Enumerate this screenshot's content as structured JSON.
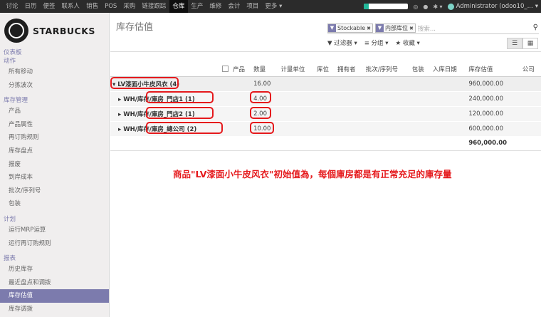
{
  "topbar": {
    "menu": [
      "讨论",
      "日历",
      "便签",
      "联系人",
      "销售",
      "POS",
      "采购",
      "链接跟踪",
      "仓库",
      "生产",
      "维修",
      "会计",
      "项目",
      "更多 ▾"
    ],
    "active_index": 8,
    "progress_fraction": 0.1,
    "user_label": "Administrator (odoo10_...",
    "icons": [
      "camera-icon",
      "chat-icon",
      "gear-icon"
    ]
  },
  "sidebar": {
    "brand": "STARBUCKS",
    "sections": [
      {
        "title": "仪表板",
        "items": []
      },
      {
        "title": "动作",
        "items": [
          "所有移动",
          "分拣波次"
        ]
      },
      {
        "title": "库存管理",
        "items": [
          "产品",
          "产品属性",
          "再订购规则",
          "库存盘点",
          "报废",
          "到岸成本",
          "批次/序列号",
          "包装"
        ]
      },
      {
        "title": "计划",
        "items": [
          "运行MRP运算",
          "运行再订购规则"
        ]
      },
      {
        "title": "报表",
        "items": [
          "历史库存",
          "最近盘点和调拨",
          "库存估值",
          "库存调拨"
        ]
      }
    ],
    "active_item": "库存估值"
  },
  "page": {
    "title": "库存估值",
    "facets": [
      {
        "label": "Stockable",
        "icon": "filter-icon"
      },
      {
        "label": "内部库位",
        "icon": "filter-icon"
      }
    ],
    "search_placeholder": "搜索...",
    "filter_label": "▼ 过滤器 ▾",
    "group_label": "≡ 分组 ▾",
    "favorites_label": "★ 收藏 ▾"
  },
  "table": {
    "columns": [
      "产品",
      "数量",
      "计量单位",
      "库位",
      "拥有者",
      "批次/序列号",
      "包装",
      "入库日期",
      "库存估值",
      "公司"
    ],
    "group": {
      "label": "▾ LV漆面小牛皮风衣 (4)",
      "quantity": "16.00",
      "value": "960,000.00"
    },
    "rows": [
      {
        "label": "▸ WH/库存/庫房_門店1 (1)",
        "quantity": "4.00",
        "value": "240,000.00"
      },
      {
        "label": "▸ WH/库存/庫房_門店2 (1)",
        "quantity": "2.00",
        "value": "120,000.00"
      },
      {
        "label": "▸ WH/库存/庫房_總公司 (2)",
        "quantity": "10.00",
        "value": "600,000.00"
      }
    ],
    "total_value": "960,000.00"
  },
  "annotation": "商品\"LV漆面小牛皮风衣\"初始值為，每個庫房都是有正常充足的庫存量",
  "colors": {
    "accent": "#7c7bad",
    "highlight": "#e5191c",
    "topbar": "#2b2b2b"
  }
}
